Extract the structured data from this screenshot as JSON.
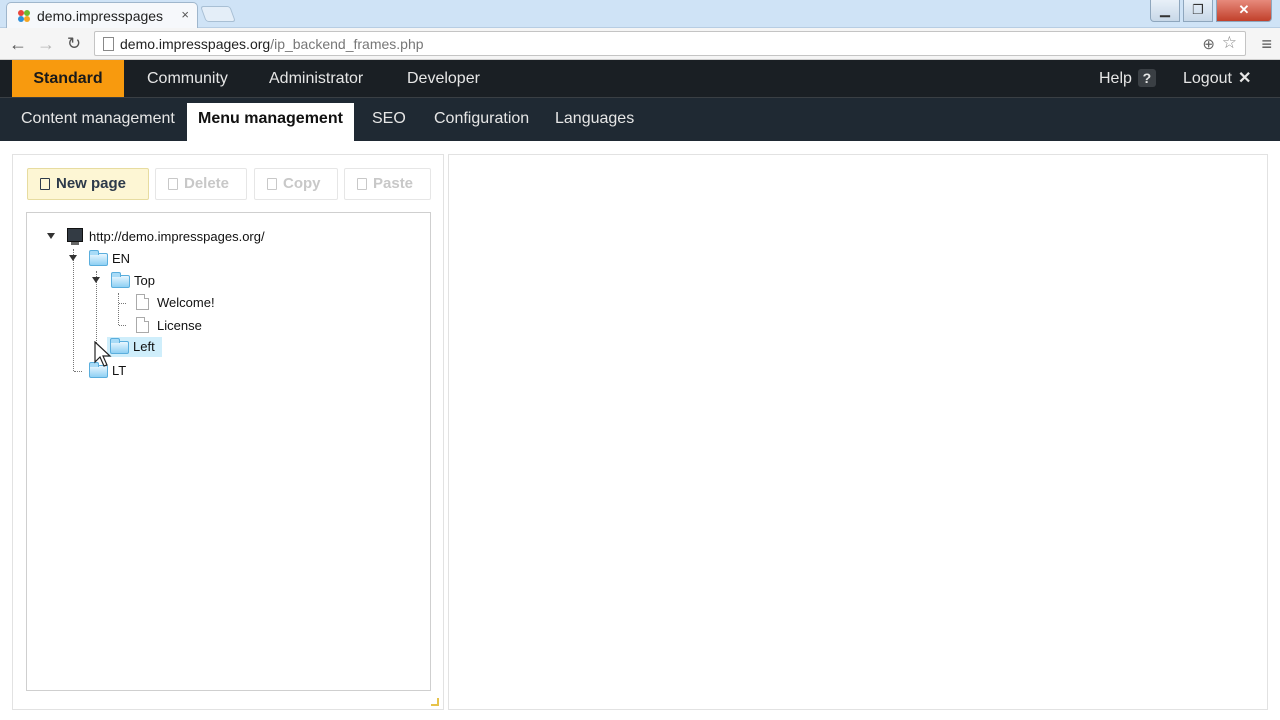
{
  "browser": {
    "tab_title": "demo.impresspages",
    "tab_close": "×",
    "url_host": "demo.impresspages.org",
    "url_path": "/ip_backend_frames.php",
    "window_controls": {
      "minimize": "▁",
      "maximize": "❐",
      "close": "✕"
    },
    "nav": {
      "back": "←",
      "forward": "→",
      "reload": "↻",
      "zoom": "⊕",
      "star": "☆",
      "menu": "≡"
    }
  },
  "topnav": {
    "items": [
      {
        "label": "Standard",
        "active": true
      },
      {
        "label": "Community"
      },
      {
        "label": "Administrator"
      },
      {
        "label": "Developer"
      }
    ],
    "help_label": "Help",
    "help_icon": "?",
    "logout_label": "Logout",
    "logout_icon": "✕"
  },
  "subnav": {
    "items": [
      {
        "label": "Content management"
      },
      {
        "label": "Menu management",
        "active": true
      },
      {
        "label": "SEO"
      },
      {
        "label": "Configuration"
      },
      {
        "label": "Languages"
      }
    ]
  },
  "toolbar": {
    "new_page": "New page",
    "delete": "Delete",
    "copy": "Copy",
    "paste": "Paste"
  },
  "tree": {
    "root": "http://demo.impresspages.org/",
    "en": "EN",
    "top": "Top",
    "welcome": "Welcome!",
    "license": "License",
    "left": "Left",
    "lt": "LT"
  }
}
